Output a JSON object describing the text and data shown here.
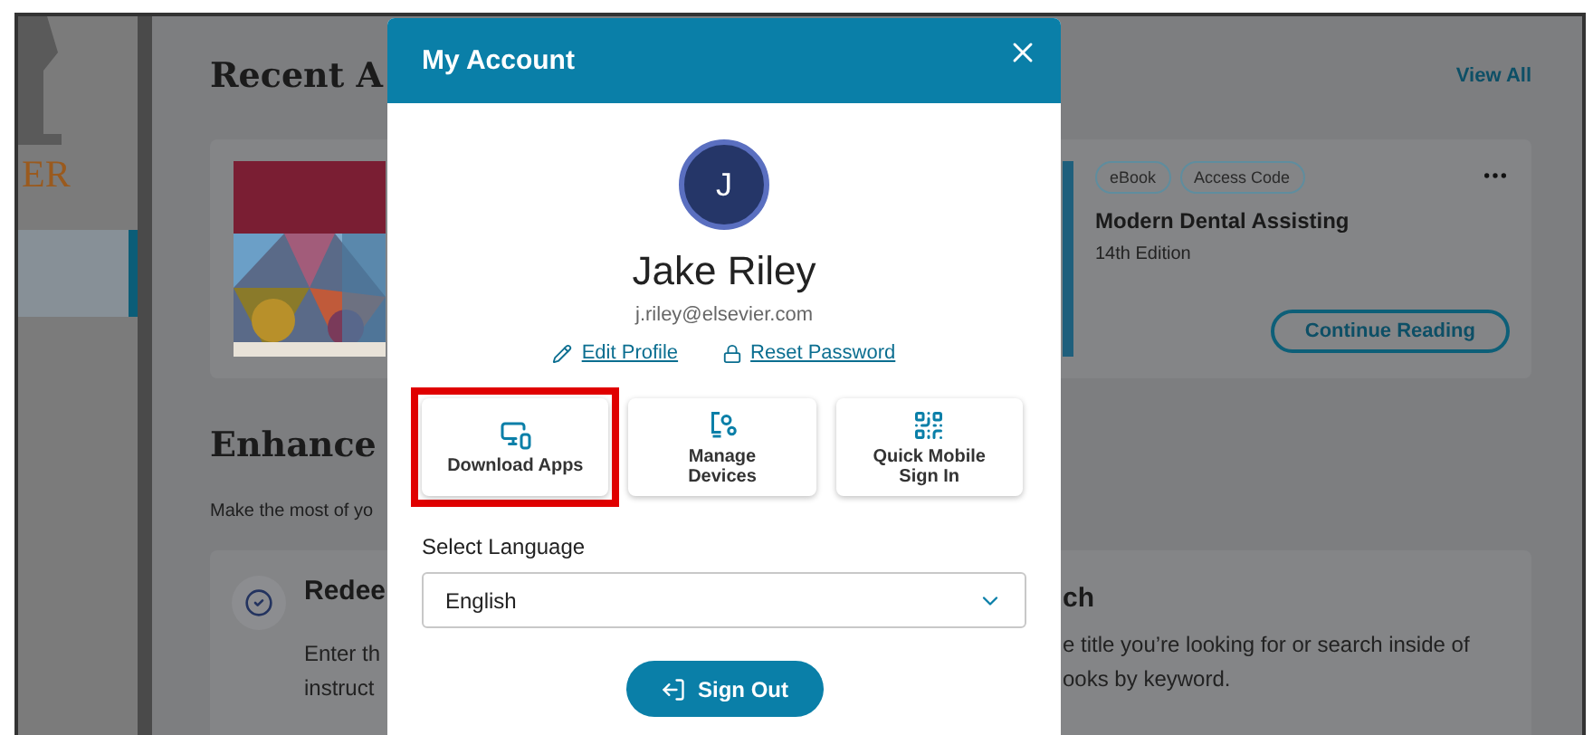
{
  "sidebar": {
    "logo_text": "ER"
  },
  "recent": {
    "title": "Recent A",
    "view_all": "View All",
    "book": {
      "tags": [
        "eBook",
        "Access Code"
      ],
      "title": "Modern Dental Assisting",
      "edition": "14th Edition",
      "action": "Continue Reading"
    }
  },
  "enhance": {
    "title": "Enhance",
    "subtitle": "Make the most of yo",
    "card": {
      "left": {
        "title": "Redee",
        "lines": [
          "Enter th",
          "instruct"
        ]
      },
      "right": {
        "title": "ch",
        "lines": [
          "e title you’re looking for or search inside of",
          "ooks by keyword."
        ]
      }
    }
  },
  "modal": {
    "title": "My Account",
    "avatar": "J",
    "name": "Jake Riley",
    "email": "j.riley@elsevier.com",
    "links": [
      {
        "label": "Edit Profile",
        "kind": "edit"
      },
      {
        "label": "Reset Password",
        "kind": "lock"
      }
    ],
    "tiles": [
      {
        "label": "Download Apps",
        "kind": "apps",
        "highlighted": true
      },
      {
        "label": "Manage Devices",
        "kind": "devices",
        "highlighted": false
      },
      {
        "label": "Quick Mobile Sign In",
        "kind": "qr",
        "highlighted": false
      }
    ],
    "language": {
      "label": "Select Language",
      "value": "English"
    },
    "sign_out": "Sign Out"
  }
}
